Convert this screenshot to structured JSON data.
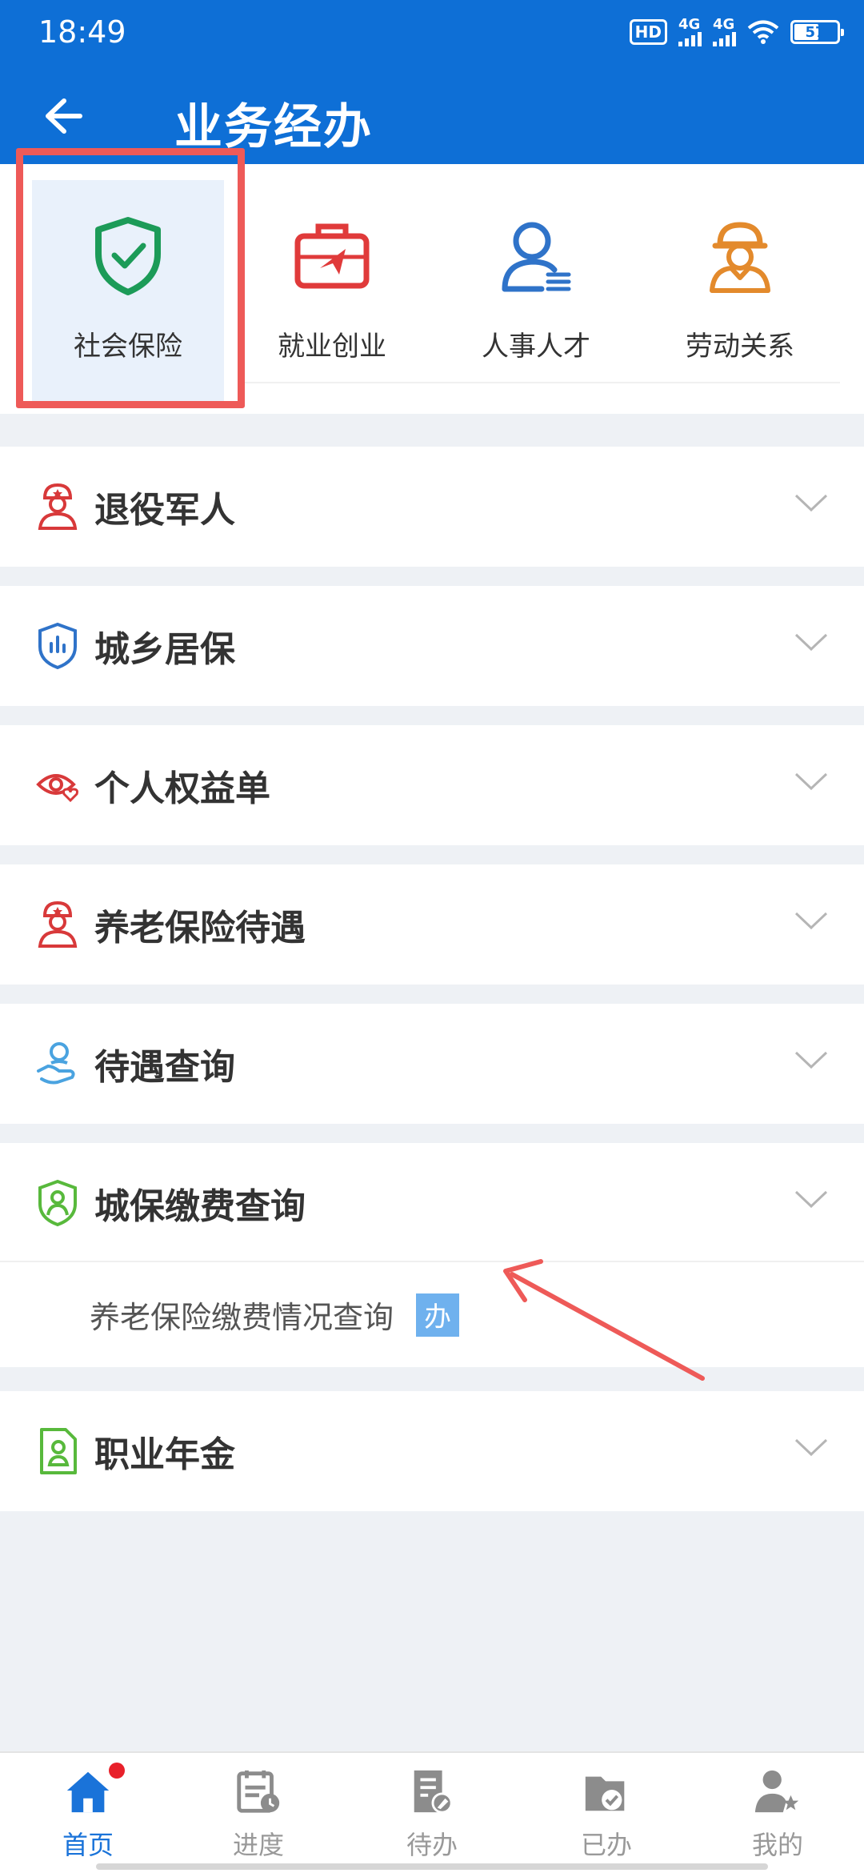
{
  "status_bar": {
    "time": "18:49",
    "hd": "HD",
    "signal_1": "4G",
    "signal_2": "4G",
    "battery": "57"
  },
  "header": {
    "title": "业务经办"
  },
  "categories": [
    {
      "label": "社会保险",
      "icon": "shield-check-icon",
      "active": true
    },
    {
      "label": "就业创业",
      "icon": "briefcase-icon"
    },
    {
      "label": "人事人才",
      "icon": "person-list-icon"
    },
    {
      "label": "劳动关系",
      "icon": "worker-icon"
    }
  ],
  "sections": [
    {
      "label": "退役军人",
      "icon": "soldier-icon"
    },
    {
      "label": "城乡居保",
      "icon": "shield-chart-icon"
    },
    {
      "label": "个人权益单",
      "icon": "eye-heart-icon"
    },
    {
      "label": "养老保险待遇",
      "icon": "soldier-icon"
    },
    {
      "label": "待遇查询",
      "icon": "hand-person-icon"
    },
    {
      "label": "城保缴费查询",
      "icon": "shield-person-icon",
      "expanded": true
    },
    {
      "label": "职业年金",
      "icon": "document-person-icon"
    }
  ],
  "sub_item": {
    "label": "养老保险缴费情况查询",
    "badge": "办"
  },
  "tabbar": [
    {
      "label": "首页",
      "icon": "home-icon",
      "active": true
    },
    {
      "label": "进度",
      "icon": "calendar-clock-icon"
    },
    {
      "label": "待办",
      "icon": "document-edit-icon"
    },
    {
      "label": "已办",
      "icon": "folder-check-icon"
    },
    {
      "label": "我的",
      "icon": "user-star-icon"
    }
  ],
  "colors": {
    "header": "#0e6fd6",
    "annotation": "#ee5a58",
    "tab_active": "#1a73d9"
  }
}
